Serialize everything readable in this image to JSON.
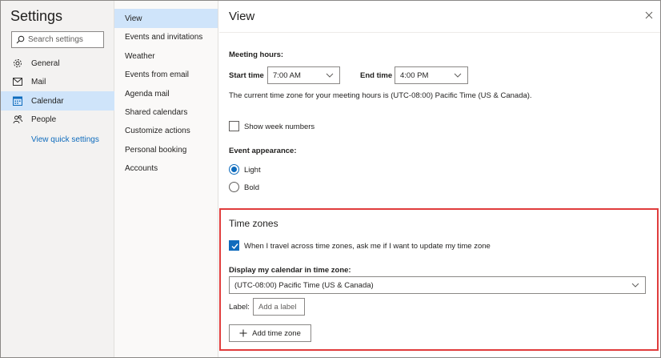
{
  "nav": {
    "title": "Settings",
    "search_placeholder": "Search settings",
    "items": [
      {
        "label": "General",
        "icon": "gear-icon"
      },
      {
        "label": "Mail",
        "icon": "mail-icon"
      },
      {
        "label": "Calendar",
        "icon": "calendar-icon",
        "active": true
      },
      {
        "label": "People",
        "icon": "people-icon"
      }
    ],
    "quick_link": "View quick settings"
  },
  "subnav": {
    "items": [
      {
        "label": "View",
        "active": true
      },
      {
        "label": "Events and invitations"
      },
      {
        "label": "Weather"
      },
      {
        "label": "Events from email"
      },
      {
        "label": "Agenda mail"
      },
      {
        "label": "Shared calendars"
      },
      {
        "label": "Customize actions"
      },
      {
        "label": "Personal booking"
      },
      {
        "label": "Accounts"
      }
    ]
  },
  "main": {
    "title": "View",
    "meeting_hours": {
      "heading": "Meeting hours:",
      "start_label": "Start time",
      "start_value": "7:00 AM",
      "end_label": "End time",
      "end_value": "4:00 PM",
      "note": "The current time zone for your meeting hours is (UTC-08:00) Pacific Time (US & Canada)."
    },
    "show_week_numbers": {
      "label": "Show week numbers",
      "checked": false
    },
    "event_appearance": {
      "heading": "Event appearance:",
      "options": [
        {
          "label": "Light",
          "selected": true
        },
        {
          "label": "Bold",
          "selected": false
        }
      ]
    },
    "time_zones": {
      "title": "Time zones",
      "ask_update": {
        "label": "When I travel across time zones, ask me if I want to update my time zone",
        "checked": true
      },
      "display_label": "Display my calendar in time zone:",
      "display_value": "(UTC-08:00) Pacific Time (US & Canada)",
      "label_field_label": "Label:",
      "label_placeholder": "Add a label",
      "add_button": "Add time zone"
    }
  },
  "colors": {
    "accent": "#0f6cbd",
    "highlight_border": "#e03c3c",
    "active_item_bg": "#cfe4fa"
  }
}
